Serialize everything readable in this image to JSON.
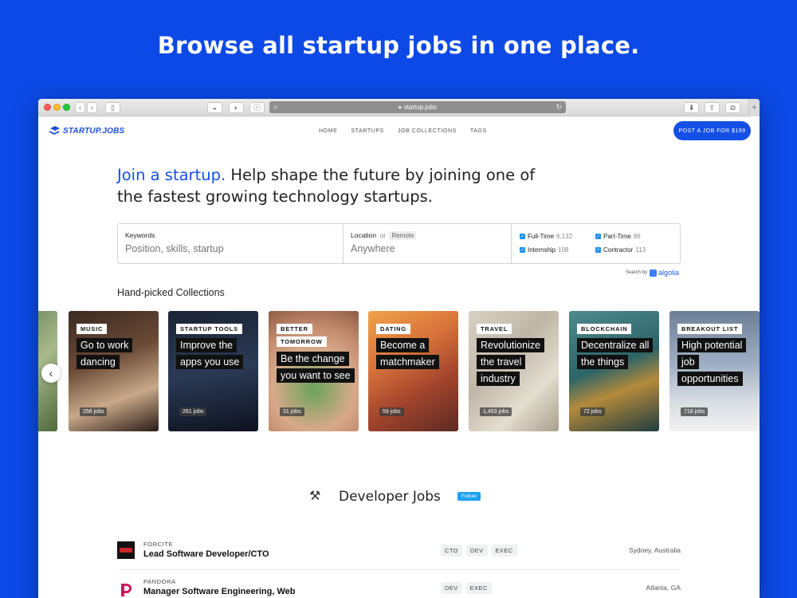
{
  "headline": "Browse all startup jobs in one place.",
  "browser": {
    "url": "startup.jobs"
  },
  "nav": {
    "logo_text": "STARTUP.JOBS",
    "links": [
      "HOME",
      "STARTUPS",
      "JOB COLLECTIONS",
      "TAGS"
    ],
    "cta": "POST A JOB FOR $199"
  },
  "hero": {
    "accent": "Join a startup.",
    "rest": " Help shape the future by joining one of the fastest growing technology startups."
  },
  "search": {
    "keywords_label": "Keywords",
    "keywords_placeholder": "Position, skills, startup",
    "location_label": "Location",
    "location_or": "or",
    "location_remote": "Remote",
    "location_placeholder": "Anywhere",
    "filters": [
      {
        "label": "Full-Time",
        "count": "6,132",
        "checked": true
      },
      {
        "label": "Part-Time",
        "count": "86",
        "checked": true
      },
      {
        "label": "Internship",
        "count": "108",
        "checked": true
      },
      {
        "label": "Contractor",
        "count": "113",
        "checked": true
      }
    ],
    "powered_by": "Search by",
    "powered_brand": "algolia"
  },
  "collections": {
    "title": "Hand-picked Collections",
    "items": [
      {
        "tag": "MUSIC",
        "tag2": "",
        "title": "Go to work dancing",
        "jobs": "256 jobs"
      },
      {
        "tag": "STARTUP TOOLS",
        "tag2": "",
        "title": "Improve the apps you use",
        "jobs": "261 jobs"
      },
      {
        "tag": "BETTER",
        "tag2": "TOMORROW",
        "title": "Be the change you want to see",
        "jobs": "31 jobs"
      },
      {
        "tag": "DATING",
        "tag2": "",
        "title": "Become a matchmaker",
        "jobs": "59 jobs"
      },
      {
        "tag": "TRAVEL",
        "tag2": "",
        "title": "Revolutionize the travel industry",
        "jobs": "1,453 jobs"
      },
      {
        "tag": "BLOCKCHAIN",
        "tag2": "",
        "title": "Decentralize all the things",
        "jobs": "72 jobs"
      },
      {
        "tag": "BREAKOUT LIST",
        "tag2": "",
        "title": "High potential job opportunities",
        "jobs": "718 jobs"
      }
    ]
  },
  "dev_jobs": {
    "title": "Developer Jobs",
    "follow": "Follow",
    "jobs": [
      {
        "company": "FORCITE",
        "title": "Lead Software Developer/CTO",
        "tags": [
          "CTO",
          "DEV",
          "EXEC"
        ],
        "location": "Sydney, Australia"
      },
      {
        "company": "PANDORA",
        "title": "Manager Software Engineering, Web",
        "tags": [
          "DEV",
          "EXEC"
        ],
        "location": "Atlanta, GA"
      }
    ]
  },
  "colors": {
    "brand_blue": "#1450e6",
    "page_bg": "#0c49e6"
  }
}
